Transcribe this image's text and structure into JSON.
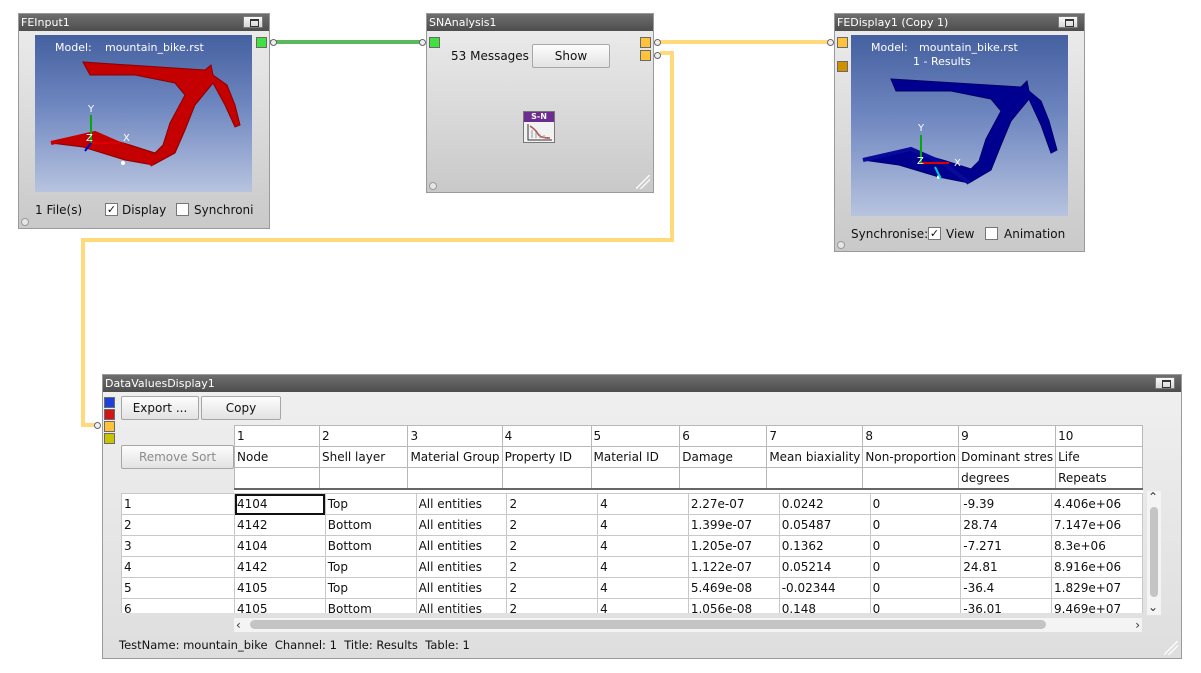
{
  "colors": {
    "link_green": "#5cb85c",
    "link_yellow": "#ffd97a",
    "frame_red": "#c40000",
    "frame_blue": "#00008b",
    "title_bar": "#5a5a5a"
  },
  "fe_input": {
    "title": "FEInput1",
    "model_label": "Model:",
    "model_value": "mountain_bike.rst",
    "axis_x": "X",
    "axis_y": "Y",
    "axis_z": "Z",
    "files": "1 File(s)",
    "display_label": "Display",
    "display_checked": true,
    "sync_label": "Synchroni",
    "sync_checked": false
  },
  "sn_analysis": {
    "title": "SNAnalysis1",
    "messages": "53 Messages",
    "show_button": "Show",
    "icon": "sn-curve-icon",
    "icon_text": "S-N"
  },
  "fe_display": {
    "title": "FEDisplay1 (Copy 1)",
    "model_label": "Model:",
    "model_value": "mountain_bike.rst",
    "subtitle": "1 - Results",
    "axis_x": "X",
    "axis_y": "Y",
    "axis_z": "Z",
    "synchronise_label": "Synchronise:",
    "view_label": "View",
    "view_checked": true,
    "animation_label": "Animation",
    "animation_checked": false
  },
  "data_values": {
    "title": "DataValuesDisplay1",
    "export_button": "Export ...",
    "copy_button": "Copy",
    "remove_sort_button": "Remove Sort",
    "column_numbers": [
      "1",
      "2",
      "3",
      "4",
      "5",
      "6",
      "7",
      "8",
      "9",
      "10"
    ],
    "column_names": [
      "Node",
      "Shell layer",
      "Material Group",
      "Property ID",
      "Material ID",
      "Damage",
      "Mean biaxiality",
      "Non-proportion",
      "Dominant stres",
      "Life"
    ],
    "column_units": [
      "",
      "",
      "",
      "",
      "",
      "",
      "",
      "",
      "degrees",
      "Repeats"
    ],
    "rows": [
      {
        "id": "1",
        "cells": [
          "4104",
          "Top",
          "All entities",
          "2",
          "4",
          "2.27e-07",
          "0.0242",
          "0",
          "-9.39",
          "4.406e+06"
        ]
      },
      {
        "id": "2",
        "cells": [
          "4142",
          "Bottom",
          "All entities",
          "2",
          "4",
          "1.399e-07",
          "0.05487",
          "0",
          "28.74",
          "7.147e+06"
        ]
      },
      {
        "id": "3",
        "cells": [
          "4104",
          "Bottom",
          "All entities",
          "2",
          "4",
          "1.205e-07",
          "0.1362",
          "0",
          "-7.271",
          "8.3e+06"
        ]
      },
      {
        "id": "4",
        "cells": [
          "4142",
          "Top",
          "All entities",
          "2",
          "4",
          "1.122e-07",
          "0.05214",
          "0",
          "24.81",
          "8.916e+06"
        ]
      },
      {
        "id": "5",
        "cells": [
          "4105",
          "Top",
          "All entities",
          "2",
          "4",
          "5.469e-08",
          "-0.02344",
          "0",
          "-36.4",
          "1.829e+07"
        ]
      },
      {
        "id": "6",
        "cells": [
          "4105",
          "Bottom",
          "All entities",
          "2",
          "4",
          "1.056e-08",
          "0.148",
          "0",
          "-36.01",
          "9.469e+07"
        ]
      }
    ],
    "status": "TestName: mountain_bike  Channel: 1  Title: Results  Table: 1"
  }
}
